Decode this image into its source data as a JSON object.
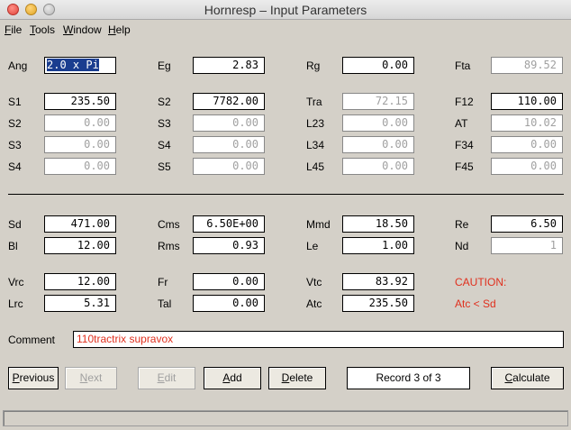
{
  "window": {
    "title": "Hornresp – Input Parameters"
  },
  "menu": [
    {
      "ul": "F",
      "rest": "ile"
    },
    {
      "ul": "T",
      "rest": "ools"
    },
    {
      "ul": "W",
      "rest": "indow"
    },
    {
      "ul": "H",
      "rest": "elp"
    }
  ],
  "params": {
    "ang": {
      "label": "Ang",
      "value": "2.0 x Pi"
    },
    "eg": {
      "label": "Eg",
      "value": "2.83"
    },
    "rg": {
      "label": "Rg",
      "value": "0.00"
    },
    "fta": {
      "label": "Fta",
      "value": "89.52"
    },
    "s1": {
      "label": "S1",
      "value": "235.50"
    },
    "s2b": {
      "label": "S2",
      "value": "7782.00"
    },
    "tra": {
      "label": "Tra",
      "value": "72.15"
    },
    "f12": {
      "label": "F12",
      "value": "110.00"
    },
    "s2": {
      "label": "S2",
      "value": "0.00"
    },
    "s3b": {
      "label": "S3",
      "value": "0.00"
    },
    "l23": {
      "label": "L23",
      "value": "0.00"
    },
    "at": {
      "label": "AT",
      "value": "10.02"
    },
    "s3": {
      "label": "S3",
      "value": "0.00"
    },
    "s4b": {
      "label": "S4",
      "value": "0.00"
    },
    "l34": {
      "label": "L34",
      "value": "0.00"
    },
    "f34": {
      "label": "F34",
      "value": "0.00"
    },
    "s4": {
      "label": "S4",
      "value": "0.00"
    },
    "s5": {
      "label": "S5",
      "value": "0.00"
    },
    "l45": {
      "label": "L45",
      "value": "0.00"
    },
    "f45": {
      "label": "F45",
      "value": "0.00"
    },
    "sd": {
      "label": "Sd",
      "value": "471.00"
    },
    "cms": {
      "label": "Cms",
      "value": "6.50E+00"
    },
    "mmd": {
      "label": "Mmd",
      "value": "18.50"
    },
    "re": {
      "label": "Re",
      "value": "6.50"
    },
    "bl": {
      "label": "Bl",
      "value": "12.00"
    },
    "rms": {
      "label": "Rms",
      "value": "0.93"
    },
    "le": {
      "label": "Le",
      "value": "1.00"
    },
    "nd": {
      "label": "Nd",
      "value": "1"
    },
    "vrc": {
      "label": "Vrc",
      "value": "12.00"
    },
    "fr": {
      "label": "Fr",
      "value": "0.00"
    },
    "vtc": {
      "label": "Vtc",
      "value": "83.92"
    },
    "lrc": {
      "label": "Lrc",
      "value": "5.31"
    },
    "tal": {
      "label": "Tal",
      "value": "0.00"
    },
    "atc": {
      "label": "Atc",
      "value": "235.50"
    }
  },
  "caution": {
    "title": "CAUTION:",
    "message": "Atc < Sd",
    "color": "#e0301e"
  },
  "comment": {
    "label": "Comment",
    "value": "110tractrix supravox"
  },
  "buttons": {
    "previous": {
      "ul": "P",
      "rest": "revious"
    },
    "next": {
      "ul": "N",
      "rest": "ext"
    },
    "edit": {
      "ul": "E",
      "rest": "dit"
    },
    "add": {
      "ul": "A",
      "rest": "dd"
    },
    "delete": {
      "ul": "D",
      "rest": "elete"
    },
    "calculate": {
      "ul": "C",
      "rest": "alculate"
    }
  },
  "record": "Record 3 of 3"
}
